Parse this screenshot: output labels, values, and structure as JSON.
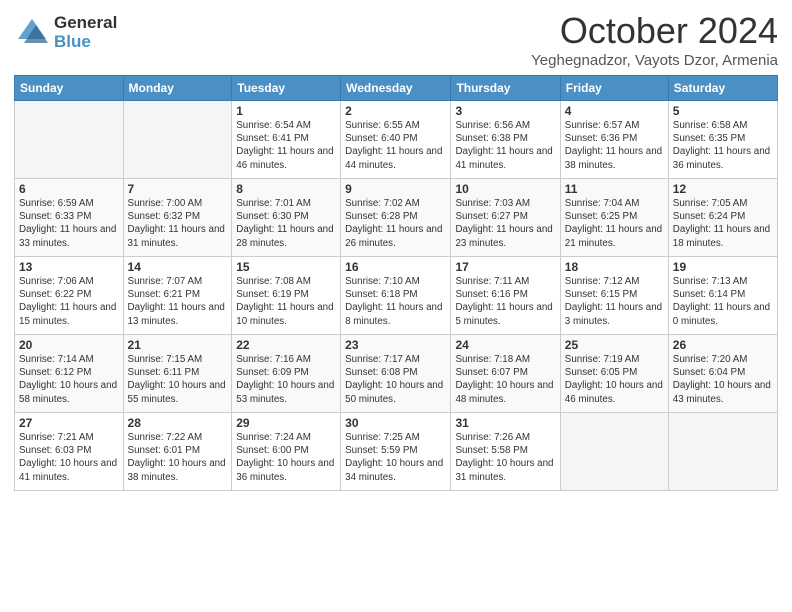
{
  "logo": {
    "general": "General",
    "blue": "Blue"
  },
  "header": {
    "month": "October 2024",
    "location": "Yeghegnadzor, Vayots Dzor, Armenia"
  },
  "weekdays": [
    "Sunday",
    "Monday",
    "Tuesday",
    "Wednesday",
    "Thursday",
    "Friday",
    "Saturday"
  ],
  "weeks": [
    [
      {
        "day": "",
        "info": ""
      },
      {
        "day": "",
        "info": ""
      },
      {
        "day": "1",
        "info": "Sunrise: 6:54 AM\nSunset: 6:41 PM\nDaylight: 11 hours and 46 minutes."
      },
      {
        "day": "2",
        "info": "Sunrise: 6:55 AM\nSunset: 6:40 PM\nDaylight: 11 hours and 44 minutes."
      },
      {
        "day": "3",
        "info": "Sunrise: 6:56 AM\nSunset: 6:38 PM\nDaylight: 11 hours and 41 minutes."
      },
      {
        "day": "4",
        "info": "Sunrise: 6:57 AM\nSunset: 6:36 PM\nDaylight: 11 hours and 38 minutes."
      },
      {
        "day": "5",
        "info": "Sunrise: 6:58 AM\nSunset: 6:35 PM\nDaylight: 11 hours and 36 minutes."
      }
    ],
    [
      {
        "day": "6",
        "info": "Sunrise: 6:59 AM\nSunset: 6:33 PM\nDaylight: 11 hours and 33 minutes."
      },
      {
        "day": "7",
        "info": "Sunrise: 7:00 AM\nSunset: 6:32 PM\nDaylight: 11 hours and 31 minutes."
      },
      {
        "day": "8",
        "info": "Sunrise: 7:01 AM\nSunset: 6:30 PM\nDaylight: 11 hours and 28 minutes."
      },
      {
        "day": "9",
        "info": "Sunrise: 7:02 AM\nSunset: 6:28 PM\nDaylight: 11 hours and 26 minutes."
      },
      {
        "day": "10",
        "info": "Sunrise: 7:03 AM\nSunset: 6:27 PM\nDaylight: 11 hours and 23 minutes."
      },
      {
        "day": "11",
        "info": "Sunrise: 7:04 AM\nSunset: 6:25 PM\nDaylight: 11 hours and 21 minutes."
      },
      {
        "day": "12",
        "info": "Sunrise: 7:05 AM\nSunset: 6:24 PM\nDaylight: 11 hours and 18 minutes."
      }
    ],
    [
      {
        "day": "13",
        "info": "Sunrise: 7:06 AM\nSunset: 6:22 PM\nDaylight: 11 hours and 15 minutes."
      },
      {
        "day": "14",
        "info": "Sunrise: 7:07 AM\nSunset: 6:21 PM\nDaylight: 11 hours and 13 minutes."
      },
      {
        "day": "15",
        "info": "Sunrise: 7:08 AM\nSunset: 6:19 PM\nDaylight: 11 hours and 10 minutes."
      },
      {
        "day": "16",
        "info": "Sunrise: 7:10 AM\nSunset: 6:18 PM\nDaylight: 11 hours and 8 minutes."
      },
      {
        "day": "17",
        "info": "Sunrise: 7:11 AM\nSunset: 6:16 PM\nDaylight: 11 hours and 5 minutes."
      },
      {
        "day": "18",
        "info": "Sunrise: 7:12 AM\nSunset: 6:15 PM\nDaylight: 11 hours and 3 minutes."
      },
      {
        "day": "19",
        "info": "Sunrise: 7:13 AM\nSunset: 6:14 PM\nDaylight: 11 hours and 0 minutes."
      }
    ],
    [
      {
        "day": "20",
        "info": "Sunrise: 7:14 AM\nSunset: 6:12 PM\nDaylight: 10 hours and 58 minutes."
      },
      {
        "day": "21",
        "info": "Sunrise: 7:15 AM\nSunset: 6:11 PM\nDaylight: 10 hours and 55 minutes."
      },
      {
        "day": "22",
        "info": "Sunrise: 7:16 AM\nSunset: 6:09 PM\nDaylight: 10 hours and 53 minutes."
      },
      {
        "day": "23",
        "info": "Sunrise: 7:17 AM\nSunset: 6:08 PM\nDaylight: 10 hours and 50 minutes."
      },
      {
        "day": "24",
        "info": "Sunrise: 7:18 AM\nSunset: 6:07 PM\nDaylight: 10 hours and 48 minutes."
      },
      {
        "day": "25",
        "info": "Sunrise: 7:19 AM\nSunset: 6:05 PM\nDaylight: 10 hours and 46 minutes."
      },
      {
        "day": "26",
        "info": "Sunrise: 7:20 AM\nSunset: 6:04 PM\nDaylight: 10 hours and 43 minutes."
      }
    ],
    [
      {
        "day": "27",
        "info": "Sunrise: 7:21 AM\nSunset: 6:03 PM\nDaylight: 10 hours and 41 minutes."
      },
      {
        "day": "28",
        "info": "Sunrise: 7:22 AM\nSunset: 6:01 PM\nDaylight: 10 hours and 38 minutes."
      },
      {
        "day": "29",
        "info": "Sunrise: 7:24 AM\nSunset: 6:00 PM\nDaylight: 10 hours and 36 minutes."
      },
      {
        "day": "30",
        "info": "Sunrise: 7:25 AM\nSunset: 5:59 PM\nDaylight: 10 hours and 34 minutes."
      },
      {
        "day": "31",
        "info": "Sunrise: 7:26 AM\nSunset: 5:58 PM\nDaylight: 10 hours and 31 minutes."
      },
      {
        "day": "",
        "info": ""
      },
      {
        "day": "",
        "info": ""
      }
    ]
  ]
}
